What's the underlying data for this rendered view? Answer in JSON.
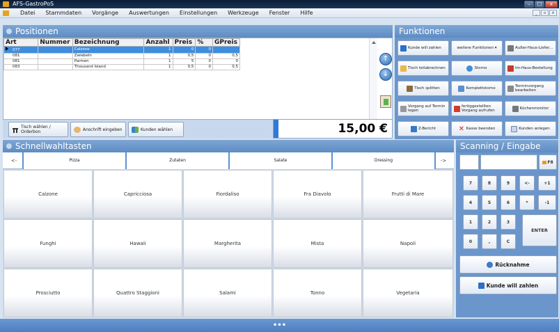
{
  "window": {
    "title": "AFS-GastroPoS",
    "controls": [
      "–",
      "□",
      "x"
    ],
    "mdi_controls": [
      "_",
      "▫",
      "x"
    ]
  },
  "menu": [
    "Datei",
    "Stammdaten",
    "Vorgänge",
    "Auswertungen",
    "Einstellungen",
    "Werkzeuge",
    "Fenster",
    "Hilfe"
  ],
  "positionen": {
    "title": "Positionen",
    "columns": [
      "Art",
      "Nummer",
      "Bezeichnung",
      "Anzahl",
      "Preis",
      "%",
      "GPreis"
    ],
    "rows": [
      {
        "art": "077",
        "nummer": "",
        "bezeichnung": "Calzone",
        "anzahl": "1",
        "preis": "0",
        "pct": "0",
        "gpreis": ""
      },
      {
        "art": "081",
        "nummer": "",
        "bezeichnung": "Zwiebeln",
        "anzahl": "1",
        "preis": "0,5",
        "pct": "0",
        "gpreis": "0,5"
      },
      {
        "art": "081",
        "nummer": "",
        "bezeichnung": "Parmen",
        "anzahl": "1",
        "preis": "5",
        "pct": "0",
        "gpreis": "0"
      },
      {
        "art": "083",
        "nummer": "",
        "bezeichnung": "Thousand Island",
        "anzahl": "1",
        "preis": "0,5",
        "pct": "0",
        "gpreis": "0,5"
      }
    ],
    "buttons": {
      "tisch": "Tisch wählen / Orderbon",
      "anschrift": "Anschrift eingeben",
      "kunden": "Kunden wählen"
    },
    "total": "15,00 €"
  },
  "funktionen": {
    "title": "Funktionen",
    "buttons": [
      "Kunde will zahlen",
      "weitere Funktionen ▾",
      "Außer-Haus-Liefer...",
      "Tisch teilabrechnen",
      "Storno",
      "Im-Haus-Bestellung",
      "Tisch splitten",
      "Komplettstorno",
      "Terminvorgang bearbeiten",
      "Vorgang auf Termin legen",
      "fertiggestellten Vorgang aufrufen",
      "Küchenmonitor",
      "Z-Bericht",
      "Kasse beenden",
      "Kunden anlegen"
    ]
  },
  "schnellwahl": {
    "title": "Schnellwahltasten",
    "nav_left": "<-",
    "nav_right": "->",
    "categories": [
      "Pizza",
      "Zutaten",
      "Salate",
      "Dressing"
    ],
    "products": [
      "Calzone",
      "Capricciosa",
      "Fiordaliso",
      "Fra Diavolo",
      "Frutti di Mare",
      "Funghi",
      "Hawaii",
      "Margherita",
      "Mista",
      "Napoli",
      "Prosciutto",
      "Quattro Staggioni",
      "Salami",
      "Tonno",
      "Vegetaria"
    ]
  },
  "scanning": {
    "title": "Scanning / Eingabe",
    "fb": "F8",
    "keys": [
      "7",
      "8",
      "9",
      "<-",
      "+1",
      "4",
      "5",
      "6",
      "*",
      "-1",
      "1",
      "2",
      "3",
      "0",
      ",",
      "C"
    ],
    "enter": "ENTER",
    "ruecknahme": "Rücknahme",
    "kunde_zahlen": "Kunde will zahlen"
  },
  "status": "•••",
  "colors": {
    "accent": "#6b96cc",
    "selected_row": "#3d8ee0",
    "title_bar": "#0b1d36"
  }
}
